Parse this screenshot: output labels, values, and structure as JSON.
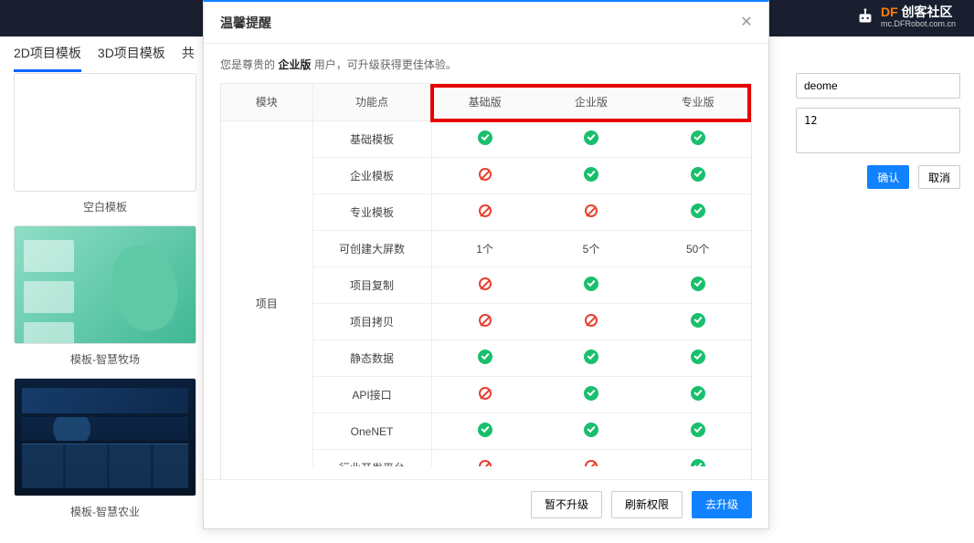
{
  "logo": {
    "brand_prefix": "DF",
    "brand_text": "创客社区",
    "sub": "mc.DFRobot.com.cn"
  },
  "tabs": {
    "t1": "2D项目模板",
    "t2": "3D项目模板",
    "t3": "共"
  },
  "templates": {
    "blank_label": "空白模板",
    "green_label": "模板-智慧牧场",
    "dark_label": "模板-智慧农业"
  },
  "right": {
    "name_value": "deome",
    "desc_value": "12",
    "confirm": "确认",
    "cancel": "取消"
  },
  "modal": {
    "title": "温馨提醒",
    "subtitle_pre": "您是尊贵的 ",
    "subtitle_bold": "企业版",
    "subtitle_post": " 用户，可升级获得更佳体验。",
    "headers": {
      "module": "模块",
      "feature": "功能点",
      "basic": "基础版",
      "enterprise": "企业版",
      "pro": "专业版"
    },
    "module1": "项目",
    "rows": [
      {
        "feature": "基础模板",
        "basic": "yes",
        "ent": "yes",
        "pro": "yes"
      },
      {
        "feature": "企业模板",
        "basic": "no",
        "ent": "yes",
        "pro": "yes"
      },
      {
        "feature": "专业模板",
        "basic": "no",
        "ent": "no",
        "pro": "yes"
      },
      {
        "feature": "可创建大屏数",
        "basic": "1个",
        "ent": "5个",
        "pro": "50个"
      },
      {
        "feature": "项目复制",
        "basic": "no",
        "ent": "yes",
        "pro": "yes"
      },
      {
        "feature": "项目拷贝",
        "basic": "no",
        "ent": "no",
        "pro": "yes"
      },
      {
        "feature": "静态数据",
        "basic": "yes",
        "ent": "yes",
        "pro": "yes"
      },
      {
        "feature": "API接口",
        "basic": "no",
        "ent": "yes",
        "pro": "yes"
      },
      {
        "feature": "OneNET",
        "basic": "yes",
        "ent": "yes",
        "pro": "yes"
      },
      {
        "feature": "行业开发平台",
        "basic": "no",
        "ent": "no",
        "pro": "yes"
      }
    ],
    "footer": {
      "later": "暂不升级",
      "refresh": "刷新权限",
      "go": "去升级"
    }
  }
}
